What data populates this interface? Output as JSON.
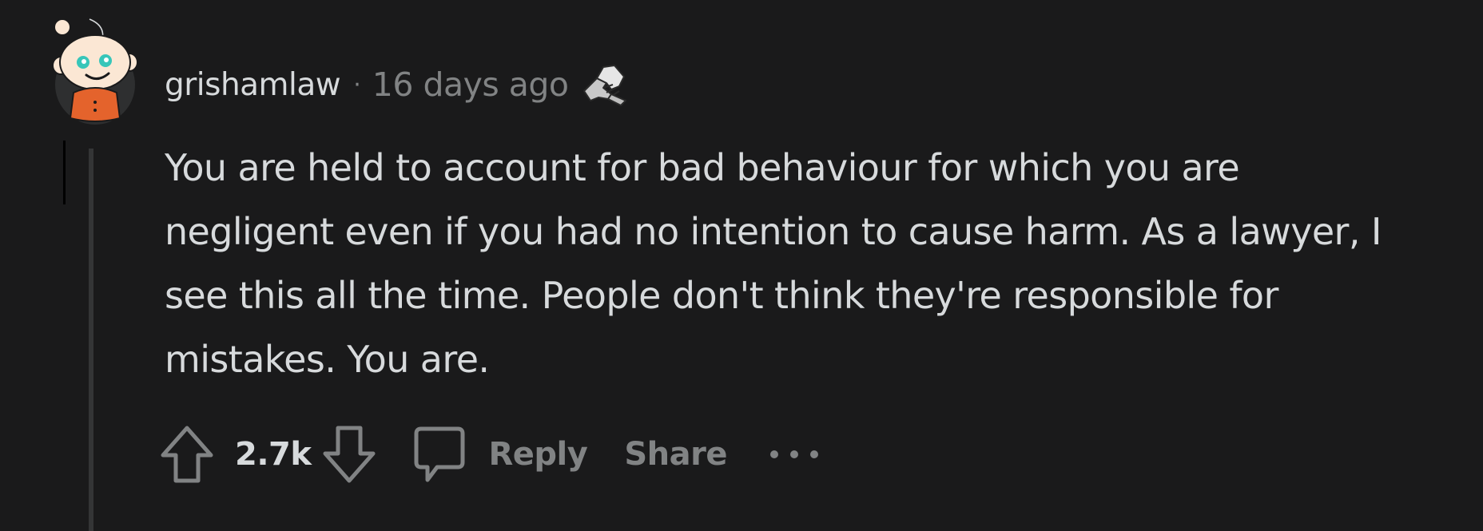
{
  "comment": {
    "author": "grishamlaw",
    "separator": "·",
    "timestamp": "16 days ago",
    "award_icon": "handshake-award-icon",
    "body": "You are held to account for bad behaviour for which you are negligent even if you had no intention to cause harm. As a lawyer, I see this all the time. People don't think they're responsible for mistakes. You are.",
    "score": "2.7k",
    "actions": {
      "reply_label": "Reply",
      "share_label": "Share"
    }
  },
  "colors": {
    "background": "#1a1a1b",
    "text_primary": "#d7dadc",
    "text_muted": "#818384",
    "thread_line": "#343536",
    "avatar_shirt": "#e4632c",
    "avatar_eyes": "#37c6b9"
  }
}
